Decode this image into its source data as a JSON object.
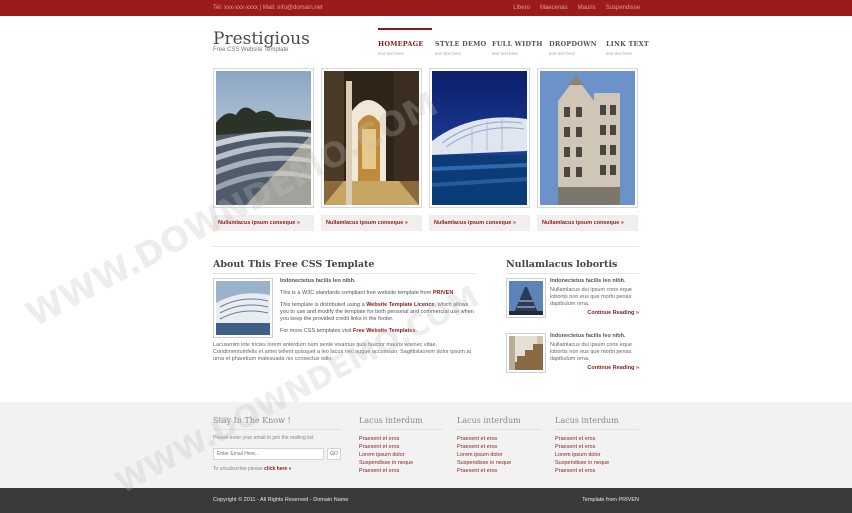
{
  "topbar": {
    "contact": "Tel: xxx-xxx-xxxx | Mail: info@domain.net",
    "links": [
      "Libero",
      "Maecenas",
      "Mauris",
      "Suspendisse"
    ]
  },
  "header": {
    "title": "Prestigious",
    "subtitle": "Free CSS Website Template"
  },
  "nav": [
    {
      "label": "HOMEPAGE",
      "sub": "text text here",
      "active": true
    },
    {
      "label": "STYLE DEMO",
      "sub": "text text here",
      "active": false
    },
    {
      "label": "FULL WIDTH",
      "sub": "text text here",
      "active": false
    },
    {
      "label": "DROPDOWN",
      "sub": "text text here",
      "active": false
    },
    {
      "label": "LINK TEXT",
      "sub": "text text here",
      "active": false
    }
  ],
  "gallery": {
    "captions": [
      "Nullamlacus ipsum conseque »",
      "Nullamlacus ipsum conseque »",
      "Nullamlacus ipsum conseque »",
      "Nullamlacus ipsum conseque »"
    ]
  },
  "about": {
    "heading": "About This Free CSS Template",
    "lead": "Indonectetus facilis leo nibh.",
    "p1_a": "This is a W3C standards compliant free website template from ",
    "p1_link": "PRIVEN",
    "p1_b": ".",
    "p2_a": "This template is distributed using a ",
    "p2_link": "Website Template Licence",
    "p2_b": ", which allows you to use and modify the template for both personal and commercial use when you keep the provided credit links in the footer.",
    "p3_a": "For more CSS templates visit ",
    "p3_link": "Free Website Templates",
    "p3_b": ".",
    "more": "Lacusenim inte tricies lorem anterdum nam sente vivamus quis fauctor mauris wisinec vitae. Condimentumfelis et amet tellent quisquet a leo lacus nec augue accumsan. Sagittislaorem dolor ipsum at urna et pharetium malesuada nis consectus odio."
  },
  "sidebar": {
    "heading": "Nullamlacus lobortis",
    "items": [
      {
        "title": "Indonectetus facilis leo nibh.",
        "body": "Nullamlacus dui ipsum cons eque lobortis non eus que morbi penas dapibulum orna.",
        "more": "Continue Reading »"
      },
      {
        "title": "Indonectetus facilis leo nibh.",
        "body": "Nullamlacus dui ipsum cons eque lobortis non eus que morbi penas dapibulum orna.",
        "more": "Continue Reading »"
      }
    ]
  },
  "footer": {
    "stay": {
      "heading": "Stay In The Know !",
      "note": "Please enter your email to join the mailing list",
      "email_placeholder": "Enter Email Here...",
      "go": "GO",
      "unsub_text": "To unsubscribe please ",
      "unsub_link": "click here »"
    },
    "columns": [
      {
        "heading": "Lacus interdum",
        "links": [
          "Praesent et eros",
          "Praesent et eros",
          "Lorem ipsum dolor",
          "Suspendisse in neque",
          "Praesent et eros"
        ]
      },
      {
        "heading": "Lacus interdum",
        "links": [
          "Praesent et eros",
          "Praesent et eros",
          "Lorem ipsum dolor",
          "Suspendisse in neque",
          "Praesent et eros"
        ]
      },
      {
        "heading": "Lacus interdum",
        "links": [
          "Praesent et eros",
          "Praesent et eros",
          "Lorem ipsum dolor",
          "Suspendisse in neque",
          "Praesent et eros"
        ]
      }
    ]
  },
  "bottom": {
    "copyright": "Copyright © 2011 - All Rights Reserved - Domain Name",
    "credit": "Template from PRIVEN"
  },
  "watermark": "WWW.DOWNDEMO.COM",
  "colors": {
    "accent": "#8b1a1a",
    "topbar": "#9b1a1a",
    "footer_bg": "#f2f2f2",
    "bottom_bg": "#3a3a3a"
  }
}
